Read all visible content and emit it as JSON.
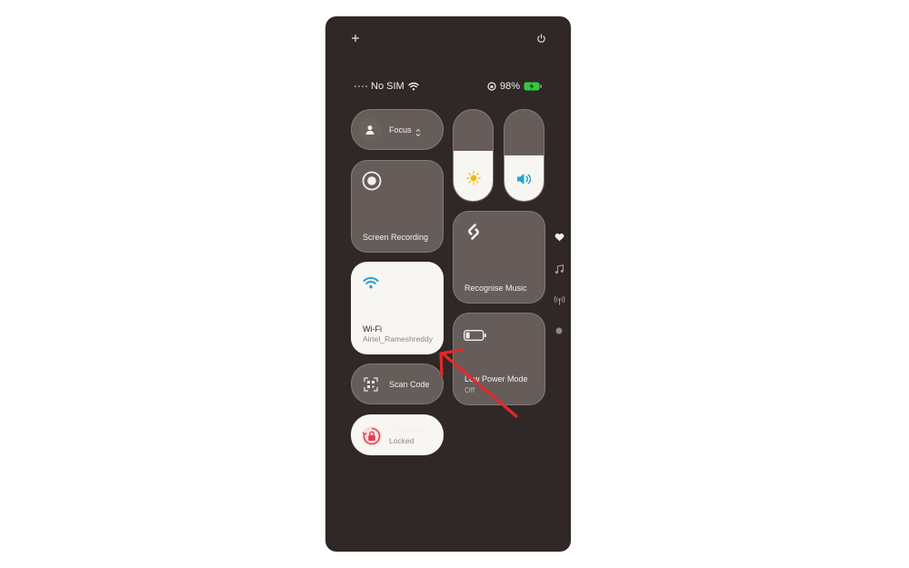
{
  "top_bar": {
    "add_icon": "plus-icon",
    "power_icon": "power-icon"
  },
  "status_bar": {
    "carrier": "No SIM",
    "battery_percent": "98%",
    "battery_color": "#2ecc40"
  },
  "focus": {
    "label": "Focus"
  },
  "brightness": {
    "level": 0.55,
    "icon": "sun-icon",
    "icon_color": "#f5b800"
  },
  "volume": {
    "level": 0.5,
    "icon": "speaker-icon",
    "icon_color": "#1ea7d6"
  },
  "screen_recording": {
    "label": "Screen Recording"
  },
  "recognise_music": {
    "label": "Recognise Music"
  },
  "wifi": {
    "label": "Wi-Fi",
    "network": "Airtel_Rameshreddy",
    "icon_color": "#2a9fd8"
  },
  "low_power": {
    "label": "Low Power Mode",
    "status": "Off"
  },
  "scan_code": {
    "label": "Scan Code"
  },
  "orientation": {
    "label": "Orientation",
    "status": "Locked",
    "icon_color": "#e0414f"
  },
  "side_pages": [
    "heart-icon",
    "music-note-icon",
    "antenna-icon",
    "dot-icon"
  ],
  "annotation": {
    "arrow_color": "#e02a2a"
  }
}
